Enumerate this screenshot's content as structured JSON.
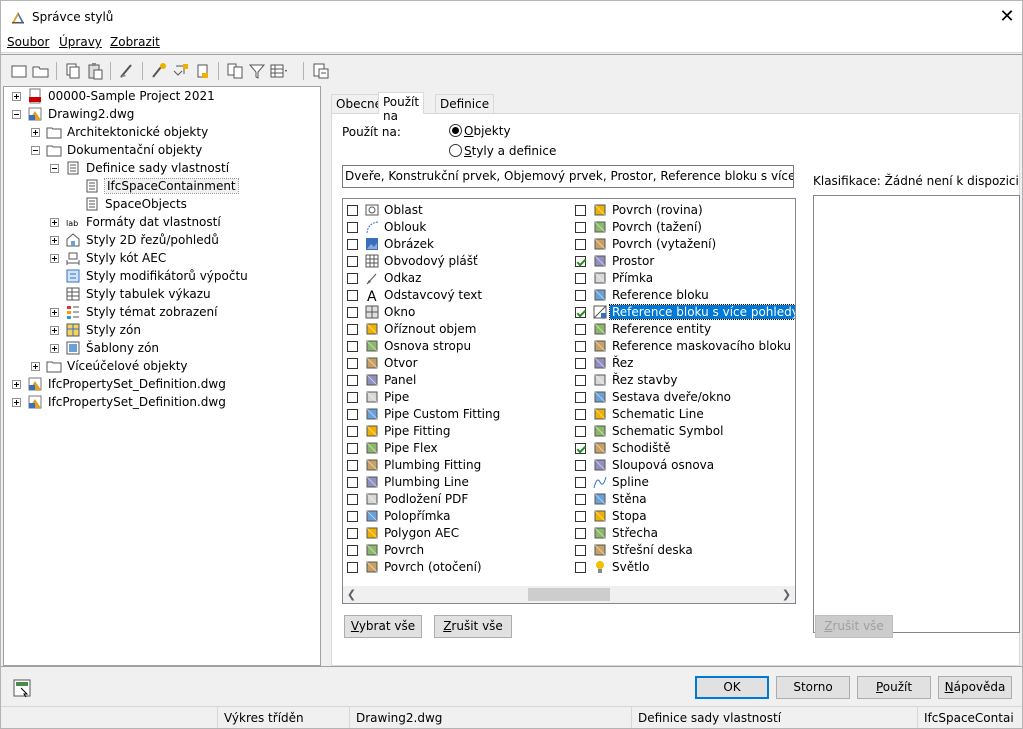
{
  "window": {
    "title": "Správce stylů",
    "close_glyph": "✕"
  },
  "menu": [
    {
      "label": "Soubor"
    },
    {
      "label": "Úpravy"
    },
    {
      "label": "Zobrazit"
    }
  ],
  "toolbar": {
    "icons": [
      "new-icon",
      "open-icon",
      "copy-icon",
      "paste-icon",
      "purge-icon",
      "edit-style-icon",
      "sort-icon",
      "import-icon",
      "compare-icon",
      "filter-icon",
      "view-toggle-icon",
      "help-browser-icon"
    ]
  },
  "tree": {
    "nodes": [
      {
        "label": "00000-Sample Project 2021",
        "level": 0,
        "icon": "pdf-icon",
        "expander": "plus"
      },
      {
        "label": "Drawing2.dwg",
        "level": 0,
        "icon": "dwg-icon",
        "expander": "minus"
      },
      {
        "label": "Architektonické objekty",
        "level": 1,
        "icon": "folder-icon",
        "expander": "plus"
      },
      {
        "label": "Dokumentační objekty",
        "level": 1,
        "icon": "folder-icon",
        "expander": "minus"
      },
      {
        "label": "Definice sady vlastností",
        "level": 2,
        "icon": "property-set-icon",
        "expander": "minus"
      },
      {
        "label": "IfcSpaceContainment",
        "level": 3,
        "icon": "property-set-icon",
        "expander": "",
        "selected": true
      },
      {
        "label": "SpaceObjects",
        "level": 3,
        "icon": "property-set-icon",
        "expander": ""
      },
      {
        "label": "Formáty dat vlastností",
        "level": 2,
        "icon": "data-format-icon",
        "expander": "plus"
      },
      {
        "label": "Styly 2D řezů/pohledů",
        "level": 2,
        "icon": "section-style-icon",
        "expander": "plus"
      },
      {
        "label": "Styly kót AEC",
        "level": 2,
        "icon": "dimension-style-icon",
        "expander": "plus"
      },
      {
        "label": "Styly modifikátorů výpočtu",
        "level": 2,
        "icon": "calc-modifier-icon",
        "expander": ""
      },
      {
        "label": "Styly tabulek výkazu",
        "level": 2,
        "icon": "schedule-table-icon",
        "expander": ""
      },
      {
        "label": "Styly témat zobrazení",
        "level": 2,
        "icon": "display-theme-icon",
        "expander": "plus"
      },
      {
        "label": "Styly zón",
        "level": 2,
        "icon": "zone-style-icon",
        "expander": "plus"
      },
      {
        "label": "Šablony zón",
        "level": 2,
        "icon": "zone-template-icon",
        "expander": "plus"
      },
      {
        "label": "Víceúčelové objekty",
        "level": 1,
        "icon": "folder-icon",
        "expander": "plus"
      },
      {
        "label": "IfcPropertySet_Definition.dwg",
        "level": 0,
        "icon": "dwg-icon",
        "expander": "plus"
      },
      {
        "label": "IfcPropertySet_Definition.dwg",
        "level": 0,
        "icon": "dwg-icon",
        "expander": "plus"
      }
    ]
  },
  "tabs": [
    {
      "label": "Obecné",
      "active": false
    },
    {
      "label": "Použít na",
      "active": true
    },
    {
      "label": "Definice",
      "active": false
    }
  ],
  "apply_to": {
    "label": "Použít na:",
    "options": [
      {
        "label_pre": "",
        "label_u": "O",
        "label_post": "bjekty",
        "selected": true
      },
      {
        "label_pre": "",
        "label_u": "S",
        "label_post": "tyly a definice",
        "selected": false
      }
    ],
    "summary": "Dveře, Konstrukční prvek, Objemový prvek, Prostor, Reference bloku s více pohledy, Scho..."
  },
  "objects_left": [
    {
      "label": "Oblast",
      "checked": false,
      "icon": "area-icon"
    },
    {
      "label": "Oblouk",
      "checked": false,
      "icon": "arc-icon"
    },
    {
      "label": "Obrázek",
      "checked": false,
      "icon": "image-icon"
    },
    {
      "label": "Obvodový plášť",
      "checked": false,
      "icon": "curtain-wall-icon"
    },
    {
      "label": "Odkaz",
      "checked": false,
      "icon": "leader-icon"
    },
    {
      "label": "Odstavcový text",
      "checked": false,
      "icon": "mtext-icon"
    },
    {
      "label": "Okno",
      "checked": false,
      "icon": "window-icon"
    },
    {
      "label": "Oříznout objem",
      "checked": false,
      "icon": "clip-volume-icon"
    },
    {
      "label": "Osnova stropu",
      "checked": false,
      "icon": "ceiling-grid-icon"
    },
    {
      "label": "Otvor",
      "checked": false,
      "icon": "opening-icon"
    },
    {
      "label": "Panel",
      "checked": false,
      "icon": "panel-icon"
    },
    {
      "label": "Pipe",
      "checked": false,
      "icon": "pipe-icon"
    },
    {
      "label": "Pipe Custom Fitting",
      "checked": false,
      "icon": "pipe-custom-fitting-icon"
    },
    {
      "label": "Pipe Fitting",
      "checked": false,
      "icon": "pipe-fitting-icon"
    },
    {
      "label": "Pipe Flex",
      "checked": false,
      "icon": "pipe-flex-icon"
    },
    {
      "label": "Plumbing Fitting",
      "checked": false,
      "icon": "plumbing-fitting-icon"
    },
    {
      "label": "Plumbing Line",
      "checked": false,
      "icon": "plumbing-line-icon"
    },
    {
      "label": "Podložení PDF",
      "checked": false,
      "icon": "pdf-underlay-icon"
    },
    {
      "label": "Polopřímka",
      "checked": false,
      "icon": "ray-icon"
    },
    {
      "label": "Polygon AEC",
      "checked": false,
      "icon": "polygon-icon"
    },
    {
      "label": "Povrch",
      "checked": false,
      "icon": "surface-icon"
    },
    {
      "label": "Povrch (otočení)",
      "checked": false,
      "icon": "revolved-surface-icon"
    }
  ],
  "objects_right": [
    {
      "label": "Povrch (rovina)",
      "checked": false,
      "icon": "planar-surface-icon"
    },
    {
      "label": "Povrch (tažení)",
      "checked": false,
      "icon": "swept-surface-icon"
    },
    {
      "label": "Povrch (vytažení)",
      "checked": false,
      "icon": "extruded-surface-icon"
    },
    {
      "label": "Prostor",
      "checked": true,
      "icon": "space-icon"
    },
    {
      "label": "Přímka",
      "checked": false,
      "icon": "xline-icon"
    },
    {
      "label": "Reference bloku",
      "checked": false,
      "icon": "block-reference-icon"
    },
    {
      "label": "Reference bloku s více pohledy",
      "checked": true,
      "icon": "mv-block-icon",
      "highlighted": true
    },
    {
      "label": "Reference entity",
      "checked": false,
      "icon": "entity-reference-icon"
    },
    {
      "label": "Reference maskovacího bloku",
      "checked": false,
      "icon": "mask-block-icon"
    },
    {
      "label": "Řez",
      "checked": false,
      "icon": "section-icon"
    },
    {
      "label": "Řez stavby",
      "checked": false,
      "icon": "building-section-icon"
    },
    {
      "label": "Sestava dveře/okno",
      "checked": false,
      "icon": "door-window-assembly-icon"
    },
    {
      "label": "Schematic Line",
      "checked": false,
      "icon": "schematic-line-icon"
    },
    {
      "label": "Schematic Symbol",
      "checked": false,
      "icon": "schematic-symbol-icon"
    },
    {
      "label": "Schodiště",
      "checked": true,
      "icon": "stair-icon"
    },
    {
      "label": "Sloupová osnova",
      "checked": false,
      "icon": "column-grid-icon"
    },
    {
      "label": "Spline",
      "checked": false,
      "icon": "spline-icon"
    },
    {
      "label": "Stěna",
      "checked": false,
      "icon": "wall-icon"
    },
    {
      "label": "Stopa",
      "checked": false,
      "icon": "trace-icon"
    },
    {
      "label": "Střecha",
      "checked": false,
      "icon": "roof-icon"
    },
    {
      "label": "Střešní deska",
      "checked": false,
      "icon": "roof-slab-icon"
    },
    {
      "label": "Světlo",
      "checked": false,
      "icon": "light-icon"
    }
  ],
  "buttons": {
    "select_all_u": "V",
    "select_all_rest": "ybrat vše",
    "clear_all_u": "Z",
    "clear_all_rest": "rušit vše",
    "clear_all_right_u": "Z",
    "clear_all_right_rest": "rušit vše",
    "ok": "OK",
    "cancel": "Storno",
    "apply_u": "P",
    "apply_rest": "oužít",
    "help_u": "N",
    "help_rest": "ápověda"
  },
  "classification": {
    "label": "Klasifikace: Žádné není k dispozici"
  },
  "status": {
    "sort": "Výkres tříděn",
    "drawing": "Drawing2.dwg",
    "category": "Definice sady vlastností",
    "item": "IfcSpaceContai"
  },
  "colors": {
    "accent": "#0078d7",
    "check": "#2a8a2a",
    "window_bg": "#f0f0f0"
  }
}
